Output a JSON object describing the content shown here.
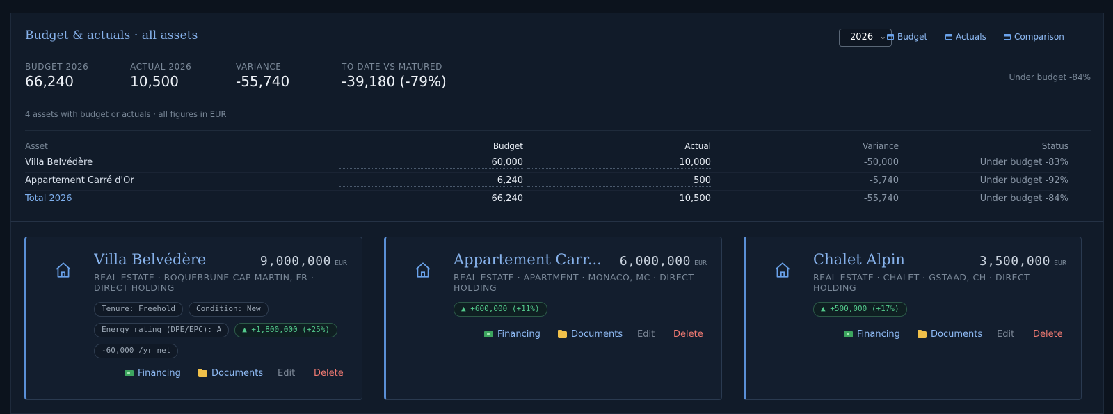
{
  "summary": {
    "title": "Budget & actuals · all assets",
    "year_selected": "2026",
    "links": {
      "budget": "Budget",
      "actuals": "Actuals",
      "comparison": "Comparison"
    },
    "stats": [
      {
        "label": "BUDGET 2026",
        "value": "66,240"
      },
      {
        "label": "ACTUAL 2026",
        "value": "10,500"
      },
      {
        "label": "VARIANCE",
        "value": "-55,740"
      },
      {
        "label": "TO DATE VS MATURED",
        "value": "-39,180 (-79%)"
      }
    ],
    "status": "Under budget -84%",
    "meta": "4 assets with budget or actuals · all figures in EUR"
  },
  "table": {
    "headers": {
      "asset": "Asset",
      "budget": "Budget",
      "actual": "Actual",
      "variance": "Variance",
      "status": "Status"
    },
    "rows": [
      {
        "asset": "Villa Belvédère",
        "budget": "60,000",
        "actual": "10,000",
        "variance": "-50,000",
        "status": "Under budget -83%"
      },
      {
        "asset": "Appartement Carré d'Or",
        "budget": "6,240",
        "actual": "500",
        "variance": "-5,740",
        "status": "Under budget -92%"
      }
    ],
    "total": {
      "asset": "Total 2026",
      "budget": "66,240",
      "actual": "10,500",
      "variance": "-55,740",
      "status": "Under budget -84%"
    }
  },
  "cards": [
    {
      "name": "Villa Belvédère",
      "value": "9,000,000",
      "currency": "EUR",
      "subtitle": "REAL ESTATE · ROQUEBRUNE-CAP-MARTIN, FR · DIRECT HOLDING",
      "chips": [
        "Tenure: Freehold",
        "Condition: New",
        "Energy rating (DPE/EPC): A",
        "▲ +1,800,000 (+25%)",
        "-60,000 /yr net"
      ],
      "actions": {
        "financing": "Financing",
        "documents": "Documents",
        "edit": "Edit",
        "delete": "Delete"
      }
    },
    {
      "name": "Appartement Carr...",
      "value": "6,000,000",
      "currency": "EUR",
      "subtitle": "REAL ESTATE · APARTMENT · MONACO, MC · DIRECT HOLDING",
      "chips": [
        "▲ +600,000 (+11%)"
      ],
      "actions": {
        "financing": "Financing",
        "documents": "Documents",
        "edit": "Edit",
        "delete": "Delete"
      }
    },
    {
      "name": "Chalet Alpin",
      "value": "3,500,000",
      "currency": "EUR",
      "subtitle": "REAL ESTATE · CHALET · GSTAAD, CH · DIRECT HOLDING",
      "chips": [
        "▲ +500,000 (+17%)"
      ],
      "actions": {
        "financing": "Financing",
        "documents": "Documents",
        "edit": "Edit",
        "delete": "Delete"
      }
    }
  ],
  "colors": {
    "accent": "#86b1ea",
    "positive": "#53c98c",
    "danger": "#f07a72",
    "background": "#0c131d"
  },
  "icons": {
    "card": "house-icon",
    "financing": "money-icon",
    "documents": "folder-icon",
    "select": "chevron-down-icon",
    "link": "table-icon"
  }
}
